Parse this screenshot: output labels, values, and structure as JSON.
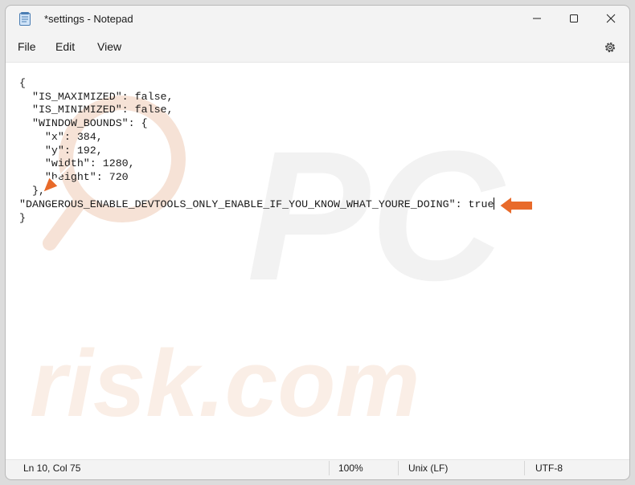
{
  "window": {
    "title": "*settings - Notepad"
  },
  "menu": {
    "file": "File",
    "edit": "Edit",
    "view": "View"
  },
  "editor": {
    "lines": [
      "{",
      "  \"IS_MAXIMIZED\": false,",
      "  \"IS_MINIMIZED\": false,",
      "  \"WINDOW_BOUNDS\": {",
      "    \"x\": 384,",
      "    \"y\": 192,",
      "    \"width\": 1280,",
      "    \"height\": 720",
      "  },",
      "\"DANGEROUS_ENABLE_DEVTOOLS_ONLY_ENABLE_IF_YOU_KNOW_WHAT_YOURE_DOING\": true",
      "}"
    ],
    "watermark_letters": "PC",
    "watermark_text": "risk.com"
  },
  "status": {
    "position": "Ln 10, Col 75",
    "zoom": "100%",
    "line_ending": "Unix (LF)",
    "encoding": "UTF-8"
  },
  "colors": {
    "arrow": "#e86a2a",
    "watermark": "#f3d6c4"
  },
  "icons": {
    "app": "notepad-icon",
    "minimize": "minimize-icon",
    "maximize": "maximize-icon",
    "close": "close-icon",
    "settings": "gear-icon",
    "pointer": "arrow-icon"
  }
}
